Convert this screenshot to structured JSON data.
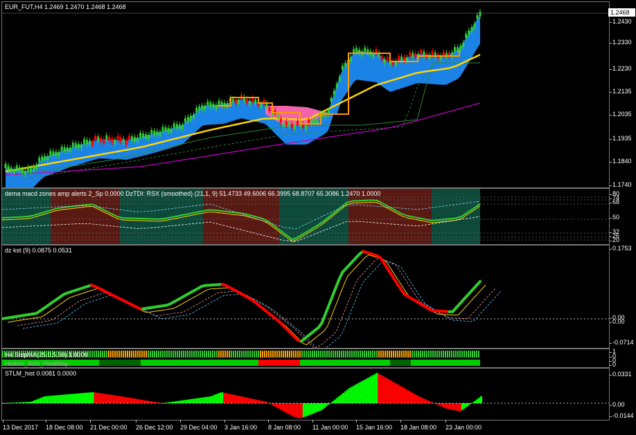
{
  "main": {
    "symbol_label": "EUR_FUT,H4  1.2469 1.2470 1.2468 1.2468",
    "current_price": "1.2468",
    "price_scale": [
      "1.2430",
      "1.2330",
      "1.2230",
      "1.2135",
      "1.2035",
      "1.1935",
      "1.1840",
      "1.1740"
    ]
  },
  "tdi": {
    "label": "dema macd zones amp alerts 2_Sp 0.0000  DzTDI:  RSX (smoothed) (21,1, 9) 51.4733 49.6006 66.3995 68.8707 65.3086 1.2470 1.0000",
    "scale": [
      "80",
      "74",
      "68",
      "50",
      "32",
      "26",
      "20"
    ]
  },
  "kst": {
    "label": "dz kst (9) 0.0875 0.0531",
    "scale": [
      "0.1753",
      "0.00",
      "0.00",
      "-0.0714"
    ]
  },
  "stepma": {
    "label": "H4 StepMA(25,0.5,50) 1.0000",
    "label2": "Heiken_Ashi_HeatMap",
    "scale": [
      "1",
      "0",
      "0",
      "0"
    ]
  },
  "stlm": {
    "label": "STLM_hist 0.0081 0.0000",
    "scale": [
      "0.0331",
      "0.00",
      "-0.0144"
    ]
  },
  "time_axis": [
    "13 Dec 2017",
    "18 Dec 08:00",
    "21 Dec 00:00",
    "26 Dec 12:00",
    "29 Dec 04:00",
    "3 Jan 16:00",
    "8 Jan 08:00",
    "11 Jan 00:00",
    "15 Jan 16:00",
    "18 Jan 08:00",
    "23 Jan 00:00"
  ],
  "colors": {
    "bull_candle": "#32cd32",
    "bear_candle": "#ff0000",
    "cloud_blue": "#1e90ff",
    "cloud_pink": "#ff69b4",
    "ma_yellow": "#ffd700",
    "ma_magenta": "#c000c0",
    "ma_orange": "#ff9900",
    "tdi_green_zone": "#0e4a3a",
    "tdi_red_zone": "#5a1a14",
    "kst_green": "#32cd32",
    "kst_red": "#ff0000"
  }
}
